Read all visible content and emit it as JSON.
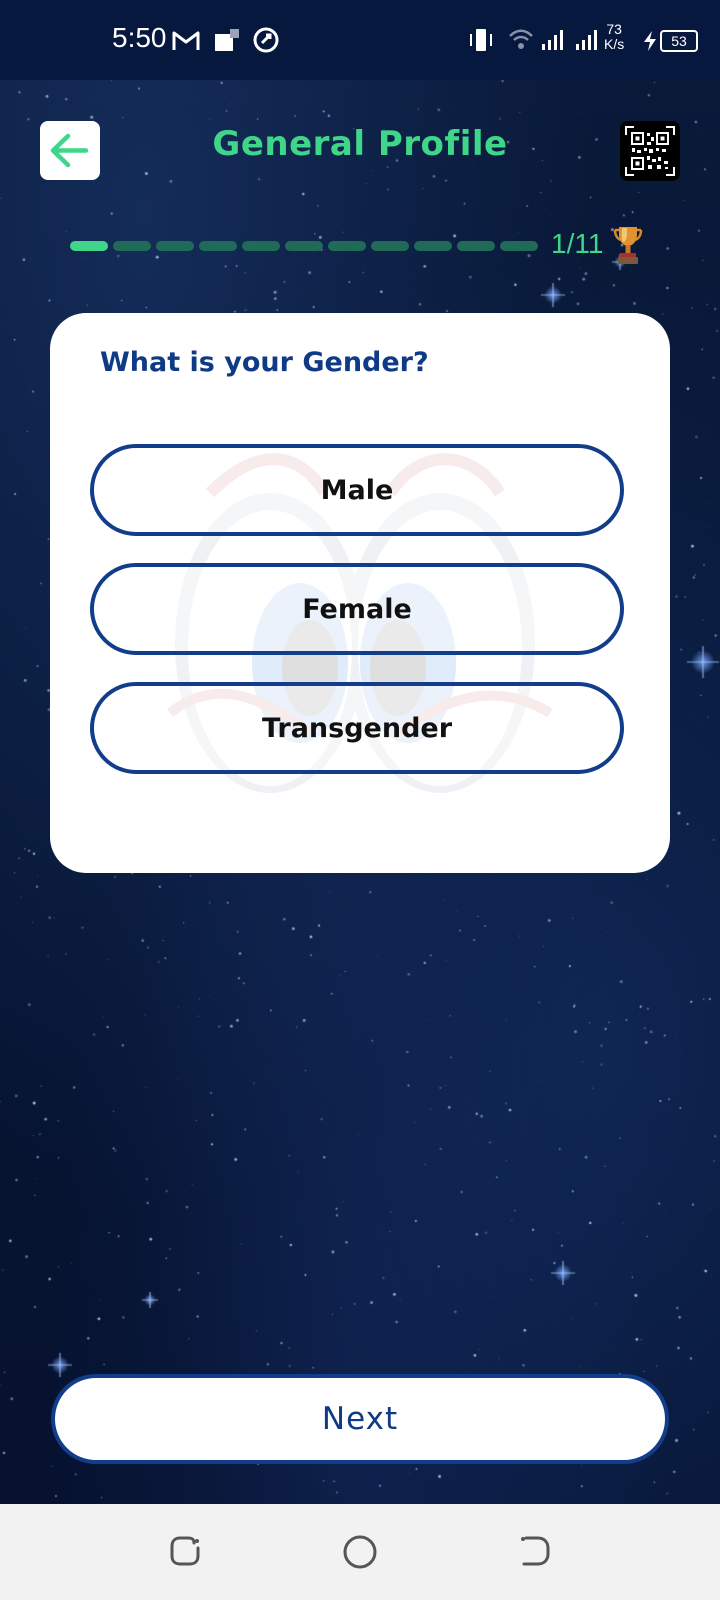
{
  "status_bar": {
    "time": "5:50",
    "net_speed_value": "73",
    "net_speed_unit": "K/s",
    "battery": "53",
    "icons": [
      "gmail-icon",
      "notification-square-icon",
      "app-circle-icon",
      "vibrate-icon",
      "wifi-icon",
      "signal-icon",
      "signal-icon",
      "charging-icon",
      "battery-icon"
    ]
  },
  "header": {
    "title": "General Profile",
    "back_icon": "arrow-left-icon",
    "qr_icon": "qr-code-icon"
  },
  "progress": {
    "current": 1,
    "total": 11,
    "label": "1/11",
    "reward_icon": "trophy-icon"
  },
  "question": {
    "text": "What is your Gender?",
    "options": [
      "Male",
      "Female",
      "Transgender"
    ]
  },
  "footer": {
    "next_label": "Next"
  },
  "nav_bar": {
    "icons": [
      "recent-apps-icon",
      "home-icon",
      "back-icon"
    ]
  },
  "colors": {
    "accent": "#3fd68a",
    "primary": "#123d8a",
    "background": "#071634"
  }
}
